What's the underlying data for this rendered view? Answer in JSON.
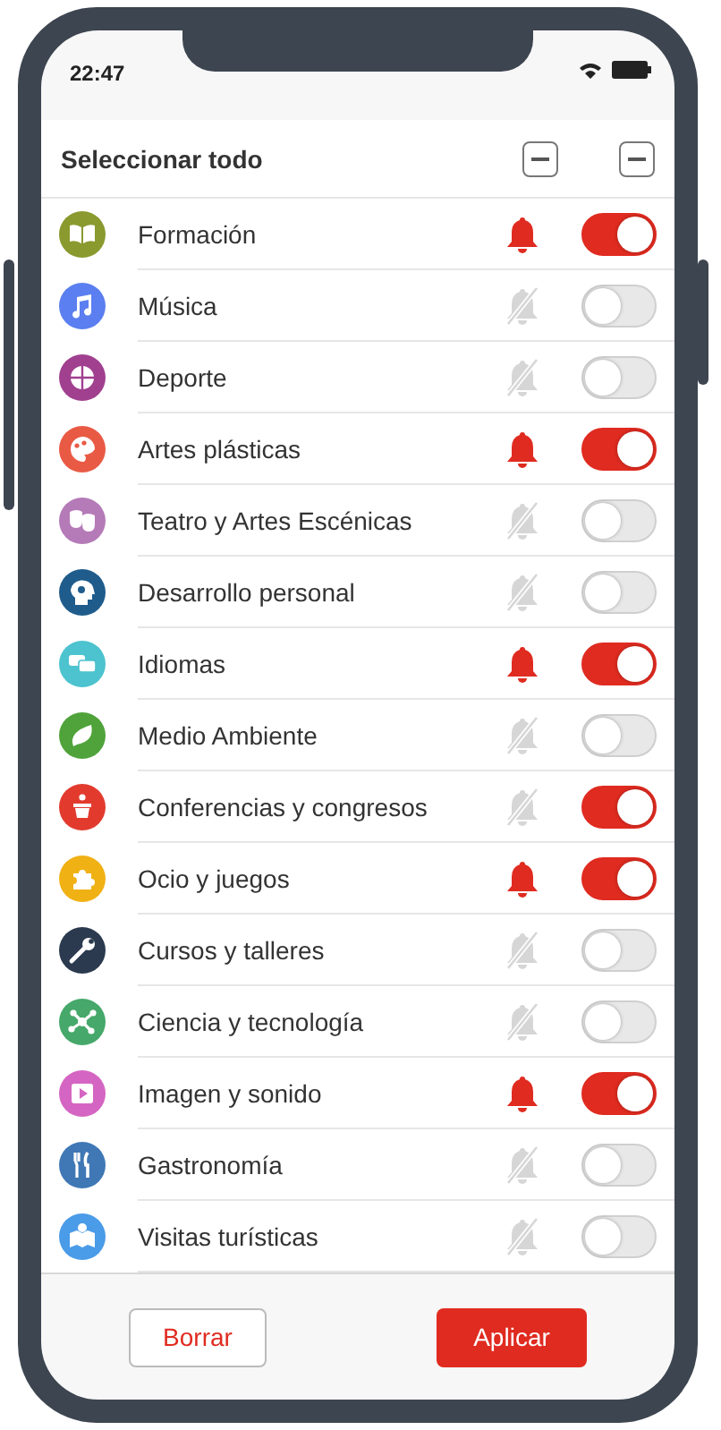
{
  "status_bar": {
    "time": "22:47"
  },
  "header": {
    "label": "Seleccionar todo",
    "checkboxes": [
      {
        "indeterminate": true
      },
      {
        "indeterminate": true
      }
    ]
  },
  "items": [
    {
      "label": "Formación",
      "color": "#8a9a2e",
      "notify": true,
      "on": true
    },
    {
      "label": "Música",
      "color": "#5b7ff0",
      "notify": false,
      "on": false
    },
    {
      "label": "Deporte",
      "color": "#a0408f",
      "notify": false,
      "on": false
    },
    {
      "label": "Artes plásticas",
      "color": "#e95a45",
      "notify": true,
      "on": true
    },
    {
      "label": "Teatro y Artes Escénicas",
      "color": "#b57ab8",
      "notify": false,
      "on": false
    },
    {
      "label": "Desarrollo personal",
      "color": "#1f5c8c",
      "notify": false,
      "on": false
    },
    {
      "label": "Idiomas",
      "color": "#4cc3cf",
      "notify": true,
      "on": true
    },
    {
      "label": "Medio Ambiente",
      "color": "#4fa33a",
      "notify": false,
      "on": false
    },
    {
      "label": "Conferencias y congresos",
      "color": "#e23b2e",
      "notify": false,
      "on": true
    },
    {
      "label": "Ocio y juegos",
      "color": "#f0b114",
      "notify": true,
      "on": true
    },
    {
      "label": "Cursos y talleres",
      "color": "#2b3a4e",
      "notify": false,
      "on": false
    },
    {
      "label": "Ciencia y tecnología",
      "color": "#46a86a",
      "notify": false,
      "on": false
    },
    {
      "label": "Imagen y sonido",
      "color": "#d565c2",
      "notify": true,
      "on": true
    },
    {
      "label": "Gastronomía",
      "color": "#3f78b5",
      "notify": false,
      "on": false
    },
    {
      "label": "Visitas turísticas",
      "color": "#4a9be8",
      "notify": false,
      "on": false
    }
  ],
  "buttons": [
    {
      "label": "Borrar",
      "kind": "secondary"
    },
    {
      "label": "Aplicar",
      "kind": "primary"
    }
  ]
}
